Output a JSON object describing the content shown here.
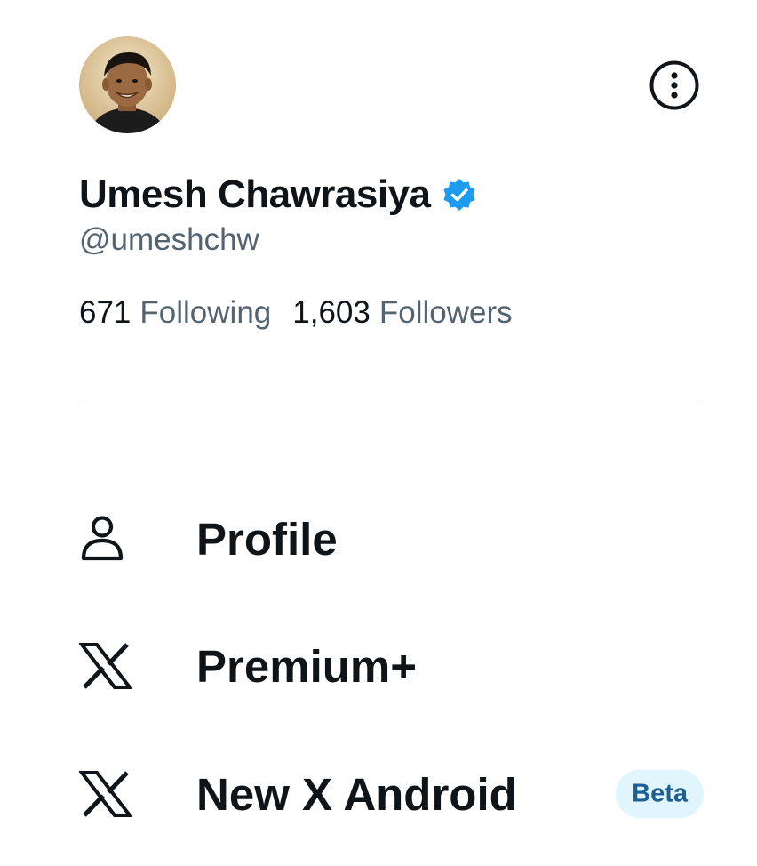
{
  "profile": {
    "display_name": "Umesh Chawrasiya",
    "handle": "@umeshchw",
    "verified": true,
    "stats": {
      "following_count": "671",
      "following_label": "Following",
      "followers_count": "1,603",
      "followers_label": "Followers"
    }
  },
  "menu": {
    "items": [
      {
        "label": "Profile",
        "icon": "person-icon"
      },
      {
        "label": "Premium+",
        "icon": "x-logo-icon"
      },
      {
        "label": "New X Android",
        "icon": "x-logo-icon",
        "badge": "Beta"
      }
    ]
  },
  "colors": {
    "primary_text": "#0f1419",
    "secondary_text": "#536471",
    "verified_blue": "#1d9bf0",
    "divider": "#cfd9de",
    "badge_bg": "#e1f5fe",
    "badge_text": "#1d5f92"
  }
}
